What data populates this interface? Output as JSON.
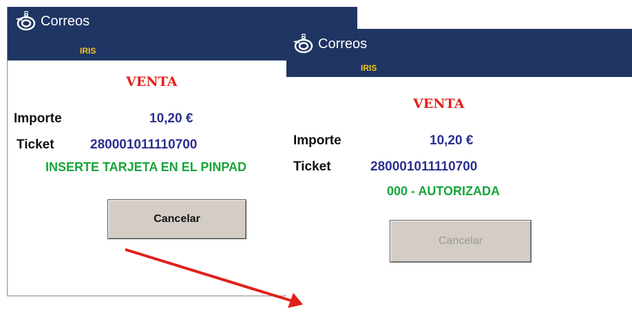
{
  "window_before": {
    "brand": "Correos",
    "sub_brand": "IRIS",
    "title": "VENTA",
    "amount_label": "Importe",
    "amount_value": "10,20 €",
    "ticket_label": "Ticket",
    "ticket_value": "280001011110700",
    "status_message": "INSERTE TARJETA EN EL PINPAD",
    "cancel_label": "Cancelar",
    "cancel_enabled": true
  },
  "window_after": {
    "brand": "Correos",
    "sub_brand": "IRIS",
    "title": "VENTA",
    "amount_label": "Importe",
    "amount_value": "10,20 €",
    "ticket_label": "Ticket",
    "ticket_value": "280001011110700",
    "status_message": "000 - AUTORIZADA",
    "cancel_label": "Cancelar",
    "cancel_enabled": false
  },
  "colors": {
    "header": "#1f3563",
    "title": "#e2211c",
    "value": "#2b2f90",
    "status": "#17a53a",
    "arrow": "#e0201b"
  }
}
